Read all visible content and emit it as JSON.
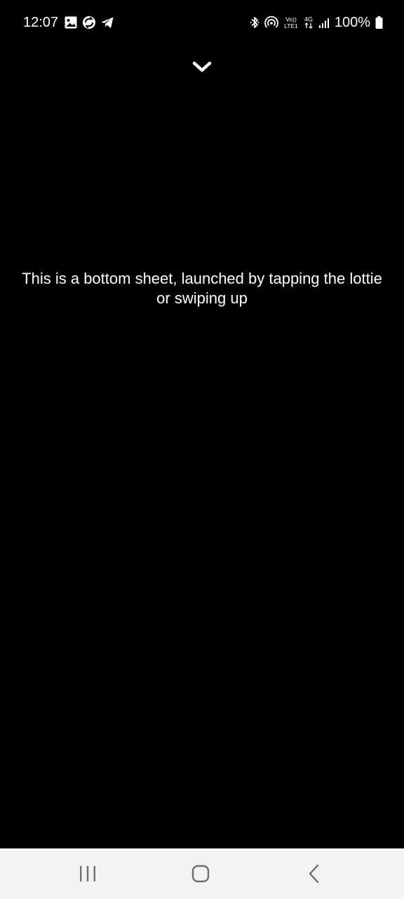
{
  "status_bar": {
    "time": "12:07",
    "battery_percent": "100%",
    "left_icons": [
      "gallery-icon",
      "sync-icon",
      "telegram-icon"
    ],
    "right_icons": [
      "bluetooth-icon",
      "hotspot-icon",
      "volte-icon",
      "4g-icon",
      "signal-icon",
      "battery-icon"
    ],
    "volte_label": "Vo))",
    "lte_label": "LTE1",
    "network_label": "4G"
  },
  "sheet": {
    "collapse_icon": "chevron-down-icon",
    "message": "This is a bottom sheet, launched by tapping the lottie or swiping up"
  },
  "nav_bar": {
    "buttons": [
      "recents-icon",
      "home-icon",
      "back-icon"
    ]
  },
  "colors": {
    "background": "#000000",
    "text": "#ffffff",
    "nav_background": "#f3f3f3",
    "nav_icon": "#6e6e6e"
  }
}
